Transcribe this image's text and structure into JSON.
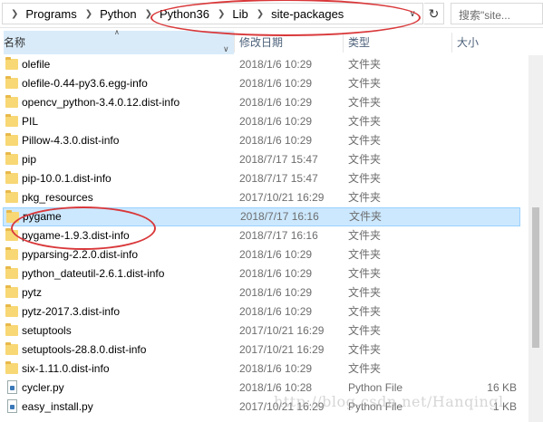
{
  "address": {
    "crumbs": [
      "Programs",
      "Python",
      "Python36",
      "Lib",
      "site-packages"
    ],
    "refresh_icon": "refresh-icon",
    "search_placeholder": "搜索\"site..."
  },
  "columns": {
    "name": "名称",
    "date": "修改日期",
    "type": "类型",
    "size": "大小"
  },
  "files": [
    {
      "name": "olefile",
      "date": "2018/1/6 10:29",
      "type": "文件夹",
      "size": "",
      "kind": "folder"
    },
    {
      "name": "olefile-0.44-py3.6.egg-info",
      "date": "2018/1/6 10:29",
      "type": "文件夹",
      "size": "",
      "kind": "folder"
    },
    {
      "name": "opencv_python-3.4.0.12.dist-info",
      "date": "2018/1/6 10:29",
      "type": "文件夹",
      "size": "",
      "kind": "folder"
    },
    {
      "name": "PIL",
      "date": "2018/1/6 10:29",
      "type": "文件夹",
      "size": "",
      "kind": "folder"
    },
    {
      "name": "Pillow-4.3.0.dist-info",
      "date": "2018/1/6 10:29",
      "type": "文件夹",
      "size": "",
      "kind": "folder"
    },
    {
      "name": "pip",
      "date": "2018/7/17 15:47",
      "type": "文件夹",
      "size": "",
      "kind": "folder"
    },
    {
      "name": "pip-10.0.1.dist-info",
      "date": "2018/7/17 15:47",
      "type": "文件夹",
      "size": "",
      "kind": "folder"
    },
    {
      "name": "pkg_resources",
      "date": "2017/10/21 16:29",
      "type": "文件夹",
      "size": "",
      "kind": "folder"
    },
    {
      "name": "pygame",
      "date": "2018/7/17 16:16",
      "type": "文件夹",
      "size": "",
      "kind": "folder",
      "selected": true
    },
    {
      "name": "pygame-1.9.3.dist-info",
      "date": "2018/7/17 16:16",
      "type": "文件夹",
      "size": "",
      "kind": "folder"
    },
    {
      "name": "pyparsing-2.2.0.dist-info",
      "date": "2018/1/6 10:29",
      "type": "文件夹",
      "size": "",
      "kind": "folder"
    },
    {
      "name": "python_dateutil-2.6.1.dist-info",
      "date": "2018/1/6 10:29",
      "type": "文件夹",
      "size": "",
      "kind": "folder"
    },
    {
      "name": "pytz",
      "date": "2018/1/6 10:29",
      "type": "文件夹",
      "size": "",
      "kind": "folder"
    },
    {
      "name": "pytz-2017.3.dist-info",
      "date": "2018/1/6 10:29",
      "type": "文件夹",
      "size": "",
      "kind": "folder"
    },
    {
      "name": "setuptools",
      "date": "2017/10/21 16:29",
      "type": "文件夹",
      "size": "",
      "kind": "folder"
    },
    {
      "name": "setuptools-28.8.0.dist-info",
      "date": "2017/10/21 16:29",
      "type": "文件夹",
      "size": "",
      "kind": "folder"
    },
    {
      "name": "six-1.11.0.dist-info",
      "date": "2018/1/6 10:29",
      "type": "文件夹",
      "size": "",
      "kind": "folder"
    },
    {
      "name": "cycler.py",
      "date": "2018/1/6 10:28",
      "type": "Python File",
      "size": "16 KB",
      "kind": "file"
    },
    {
      "name": "easy_install.py",
      "date": "2017/10/21 16:29",
      "type": "Python File",
      "size": "1 KB",
      "kind": "file"
    }
  ],
  "watermark": "http://blog.csdn.net/Hanqingl",
  "colors": {
    "selection": "#cce8ff",
    "annotation": "#d9383a",
    "folder": "#f8d775"
  }
}
